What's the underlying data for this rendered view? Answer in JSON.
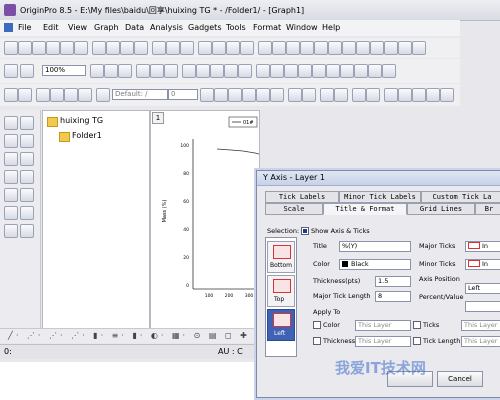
{
  "window": {
    "title": "OriginPro 8.5 - E:\\My files\\baidu\\回享\\huixing TG * - /Folder1/ - [Graph1]"
  },
  "menu": {
    "items": [
      "File",
      "Edit",
      "View",
      "Graph",
      "Data",
      "Analysis",
      "Gadgets",
      "Tools",
      "Format",
      "Window",
      "Help"
    ]
  },
  "toolbar": {
    "zoom_value": "100%",
    "font_value": "Default: /",
    "size_value": "0"
  },
  "explorer": {
    "root_label": "huixing TG",
    "folder_label": "Folder1"
  },
  "graph": {
    "page_number": "1",
    "legend_label": "01#",
    "ylabel": "Mass (%)",
    "yticks": [
      "100",
      "80",
      "60",
      "40",
      "20",
      "0"
    ],
    "xticks": [
      "100",
      "200",
      "300"
    ]
  },
  "status": {
    "left": "0:",
    "right": "AU : C"
  },
  "dialog": {
    "title": "Y Axis - Layer 1",
    "tabs_row1": [
      "Tick Labels",
      "Minor Tick Labels",
      "Custom Tick La"
    ],
    "tabs_row2": [
      "Scale",
      "Title & Format",
      "Grid Lines",
      "Br"
    ],
    "show_axis_label": "Show Axis & Ticks",
    "selection_label": "Selection:",
    "selection_items": [
      "Bottom",
      "Top",
      "Left"
    ],
    "title_label": "Title",
    "title_value": "%(Y)",
    "color_label": "Color",
    "color_value": "Black",
    "thickness_label": "Thickness(pts)",
    "thickness_value": "1.5",
    "major_len_label": "Major Tick Length",
    "major_len_value": "8",
    "major_ticks_label": "Major Ticks",
    "minor_ticks_label": "Minor Ticks",
    "major_ticks_value": "In",
    "minor_ticks_value": "In",
    "axis_pos_label": "Axis Position",
    "axis_pos_value": "Left",
    "percent_label": "Percent/Value",
    "apply_label": "Apply To",
    "apply_color": "Color",
    "apply_thickness": "Thickness",
    "apply_ticks": "Ticks",
    "apply_tick_length": "Tick Length",
    "this_layer": "This Layer",
    "cancel_label": "Cancel"
  },
  "watermark": "我爱IT技术网",
  "colors": {
    "titlebar": "#d9dce3",
    "dialog_bg": "#e9e9ee",
    "selection_red": "#d9333a",
    "curve": "#333333"
  }
}
